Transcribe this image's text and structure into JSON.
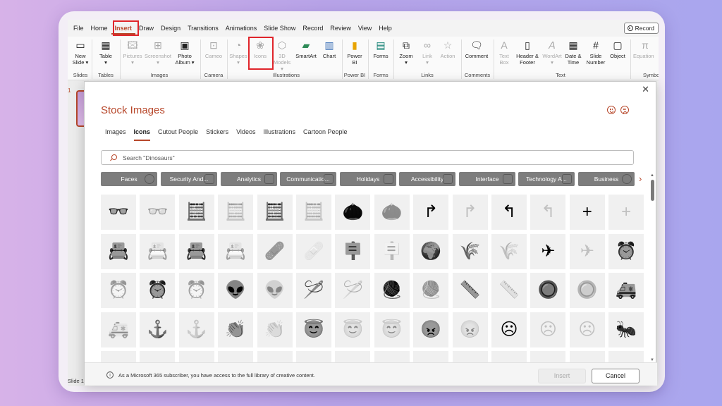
{
  "menu": {
    "items": [
      "File",
      "Home",
      "Insert",
      "Draw",
      "Design",
      "Transitions",
      "Animations",
      "Slide Show",
      "Record",
      "Review",
      "View",
      "Help"
    ],
    "active": "Insert",
    "record_label": "Record"
  },
  "ribbon": {
    "new_slide": "New Slide",
    "table": "Table",
    "pictures": "Pictures",
    "screenshot": "Screenshot",
    "photo_album": "Photo Album",
    "cameo": "Cameo",
    "shapes": "Shapes",
    "icons": "Icons",
    "models_3d": "3D Models",
    "smartart": "SmartArt",
    "chart": "Chart",
    "power_bi": "Power BI",
    "forms": "Forms",
    "zoom": "Zoom",
    "link": "Link",
    "action": "Action",
    "comment": "Comment",
    "text_box": "Text Box",
    "header_footer": "Header & Footer",
    "wordart": "WordArt",
    "date_time": "Date & Time",
    "slide_number": "Slide Number",
    "object": "Object",
    "equation": "Equation",
    "groups": {
      "slides": "Slides",
      "tables": "Tables",
      "images": "Images",
      "camera": "Camera",
      "illustrations": "Illustrations",
      "power_bi": "Power BI",
      "forms": "Forms",
      "links": "Links",
      "comments": "Comments",
      "text": "Text",
      "symbols": "Symbo"
    }
  },
  "slides_panel": {
    "number": "1",
    "status": "Slide 1"
  },
  "dialog": {
    "title": "Stock Images",
    "tabs": [
      "Images",
      "Icons",
      "Cutout People",
      "Stickers",
      "Videos",
      "Illustrations",
      "Cartoon People"
    ],
    "active_tab": "Icons",
    "search_placeholder": "Search \"Dinosaurs\"",
    "categories": [
      "Faces",
      "Security And...",
      "Analytics",
      "Communicatio...",
      "Holidays",
      "Accessibility",
      "Interface",
      "Technology A...",
      "Business"
    ],
    "icon_rows": [
      [
        "3d-glasses-filled",
        "3d-glasses-outline",
        "abacus-filled",
        "abacus-outline",
        "abacus-filled-2",
        "abacus-outline-2",
        "acorn-filled",
        "acorn-outline",
        "turn-right-filled",
        "turn-right-outline",
        "turn-left-filled",
        "turn-left-outline",
        "plus-filled",
        "plus-outline"
      ],
      [
        "address-book-filled",
        "address-book-outline",
        "address-book-filled-2",
        "address-book-outline-2",
        "bandage-filled",
        "bandage-outline",
        "billboard-filled",
        "billboard-outline",
        "africa-filled",
        "agriculture-filled",
        "agriculture-outline",
        "airplane-filled",
        "airplane-outline",
        "alarm-clock-filled"
      ],
      [
        "alarm-clock-outline",
        "alarm-ringing-filled",
        "alarm-ringing-outline",
        "alien-filled",
        "alien-outline",
        "knitting-needle-filled",
        "knitting-needle-outline",
        "yarn-ball-filled",
        "yarn-ball-outline",
        "measuring-tape-filled",
        "measuring-tape-outline",
        "button-filled",
        "button-outline",
        "ambulance-filled"
      ],
      [
        "ambulance-outline",
        "anchor-filled",
        "anchor-outline",
        "clapping-hands-filled",
        "clapping-hands-outline",
        "angel-face-filled",
        "angel-face-outline",
        "angel-face-outline-2",
        "angry-face-filled",
        "angry-face-outline",
        "frowning-face-filled",
        "frowning-face-outline",
        "frowning-face-outline-2",
        "ant-filled"
      ]
    ],
    "footer_text": "As a Microsoft 365 subscriber, you have access to the full library of creative content.",
    "insert_label": "Insert",
    "cancel_label": "Cancel",
    "colors": {
      "accent": "#b7472a",
      "category_bg": "#7d7d7d",
      "cell_bg": "#f0f0f0",
      "highlight": "#e0252b"
    }
  }
}
